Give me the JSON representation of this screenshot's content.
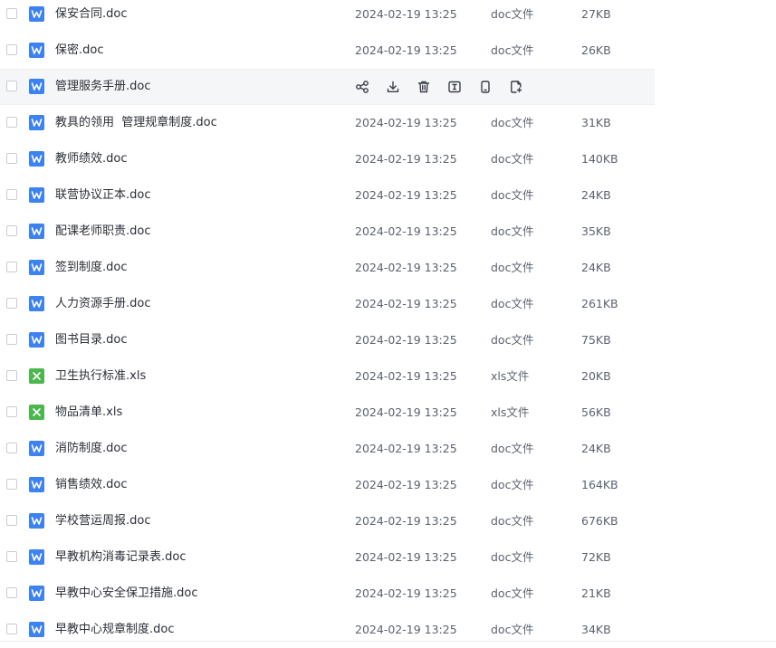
{
  "files": [
    {
      "name": "保安合同.doc",
      "modified": "2024-02-19 13:25",
      "type": "doc文件",
      "size": "27KB",
      "kind": "doc"
    },
    {
      "name": "保密.doc",
      "modified": "2024-02-19 13:25",
      "type": "doc文件",
      "size": "26KB",
      "kind": "doc"
    },
    {
      "name": "管理服务手册.doc",
      "modified": "",
      "type": "",
      "size": "",
      "kind": "doc",
      "hovered": true
    },
    {
      "name": "教具的领用  管理规章制度.doc",
      "modified": "2024-02-19 13:25",
      "type": "doc文件",
      "size": "31KB",
      "kind": "doc"
    },
    {
      "name": "教师绩效.doc",
      "modified": "2024-02-19 13:25",
      "type": "doc文件",
      "size": "140KB",
      "kind": "doc"
    },
    {
      "name": "联营协议正本.doc",
      "modified": "2024-02-19 13:25",
      "type": "doc文件",
      "size": "24KB",
      "kind": "doc"
    },
    {
      "name": "配课老师职责.doc",
      "modified": "2024-02-19 13:25",
      "type": "doc文件",
      "size": "35KB",
      "kind": "doc"
    },
    {
      "name": "签到制度.doc",
      "modified": "2024-02-19 13:25",
      "type": "doc文件",
      "size": "24KB",
      "kind": "doc"
    },
    {
      "name": "人力资源手册.doc",
      "modified": "2024-02-19 13:25",
      "type": "doc文件",
      "size": "261KB",
      "kind": "doc"
    },
    {
      "name": "图书目录.doc",
      "modified": "2024-02-19 13:25",
      "type": "doc文件",
      "size": "75KB",
      "kind": "doc"
    },
    {
      "name": "卫生执行标准.xls",
      "modified": "2024-02-19 13:25",
      "type": "xls文件",
      "size": "20KB",
      "kind": "xls"
    },
    {
      "name": "物品清单.xls",
      "modified": "2024-02-19 13:25",
      "type": "xls文件",
      "size": "56KB",
      "kind": "xls"
    },
    {
      "name": "消防制度.doc",
      "modified": "2024-02-19 13:25",
      "type": "doc文件",
      "size": "24KB",
      "kind": "doc"
    },
    {
      "name": "销售绩效.doc",
      "modified": "2024-02-19 13:25",
      "type": "doc文件",
      "size": "164KB",
      "kind": "doc"
    },
    {
      "name": "学校营运周报.doc",
      "modified": "2024-02-19 13:25",
      "type": "doc文件",
      "size": "676KB",
      "kind": "doc"
    },
    {
      "name": "早教机构消毒记录表.doc",
      "modified": "2024-02-19 13:25",
      "type": "doc文件",
      "size": "72KB",
      "kind": "doc"
    },
    {
      "name": "早教中心安全保卫措施.doc",
      "modified": "2024-02-19 13:25",
      "type": "doc文件",
      "size": "21KB",
      "kind": "doc"
    },
    {
      "name": "早教中心规章制度.doc",
      "modified": "2024-02-19 13:25",
      "type": "doc文件",
      "size": "34KB",
      "kind": "doc"
    }
  ],
  "row_actions": [
    {
      "icon": "share-icon"
    },
    {
      "icon": "download-icon"
    },
    {
      "icon": "delete-icon"
    },
    {
      "icon": "rename-icon"
    },
    {
      "icon": "mobile-icon"
    },
    {
      "icon": "copy-file-icon"
    }
  ],
  "colors": {
    "doc_icon": "#3d82f1",
    "xls_icon": "#4db74f",
    "hover_row": "#f5f6f8",
    "text": "#2b2f36",
    "muted_text": "#5b6270"
  }
}
